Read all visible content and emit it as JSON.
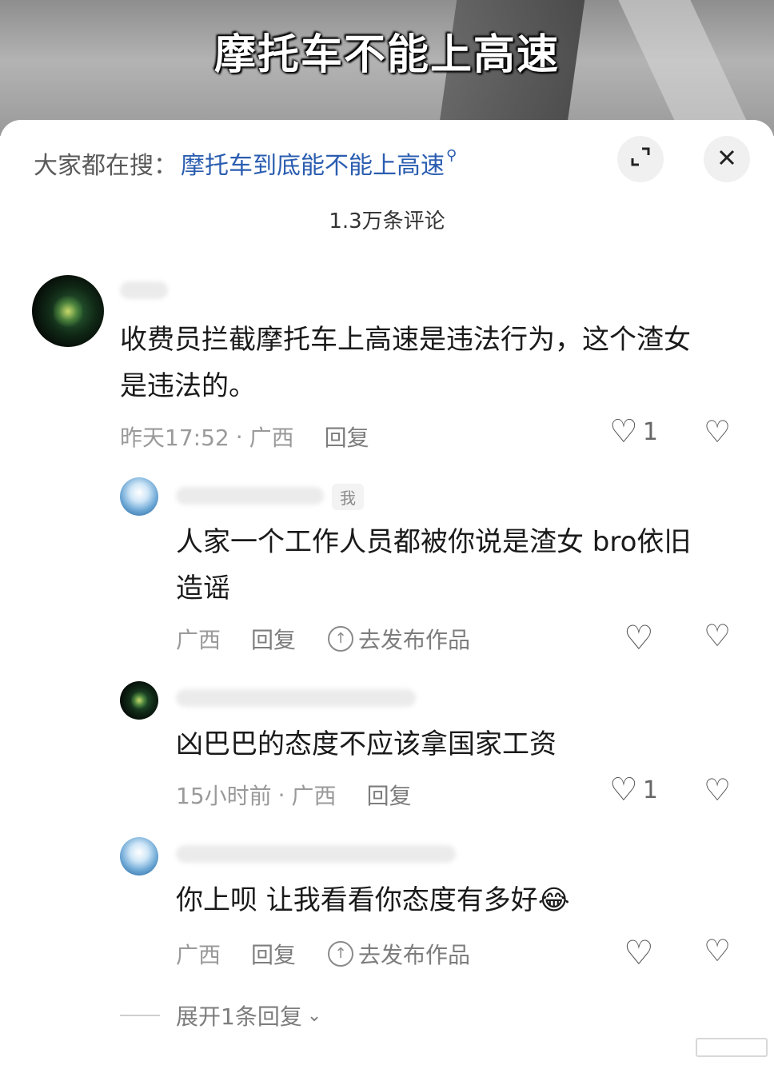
{
  "video": {
    "caption": "摩托车不能上高速"
  },
  "header": {
    "search_prefix": "大家都在搜：",
    "search_term": "摩托车到底能不能上高速",
    "search_icon": "search-icon",
    "expand_icon": "expand-icon",
    "close_icon": "close-icon",
    "comment_count": "1.3万条评论"
  },
  "comments": [
    {
      "text_line1": "收费员拦截摩托车上高速是违法行为，这个渣女",
      "text_line2": "是违法的。",
      "time": "昨天17:52",
      "location": "广西",
      "reply": "回复",
      "likes": "1"
    },
    {
      "badge": "我",
      "text_line1": "人家一个工作人员都被你说是渣女 bro依旧",
      "text_line2": "造谣",
      "location": "广西",
      "reply": "回复",
      "publish": "去发布作品"
    },
    {
      "text_line1": "凶巴巴的态度不应该拿国家工资",
      "time": "15小时前",
      "location": "广西",
      "reply": "回复",
      "likes": "1"
    },
    {
      "text_line1": "你上呗 让我看看你态度有多好",
      "emoji": "😂",
      "location": "广西",
      "reply": "回复",
      "publish": "去发布作品"
    }
  ],
  "expand_replies": "展开1条回复",
  "separator": "·"
}
